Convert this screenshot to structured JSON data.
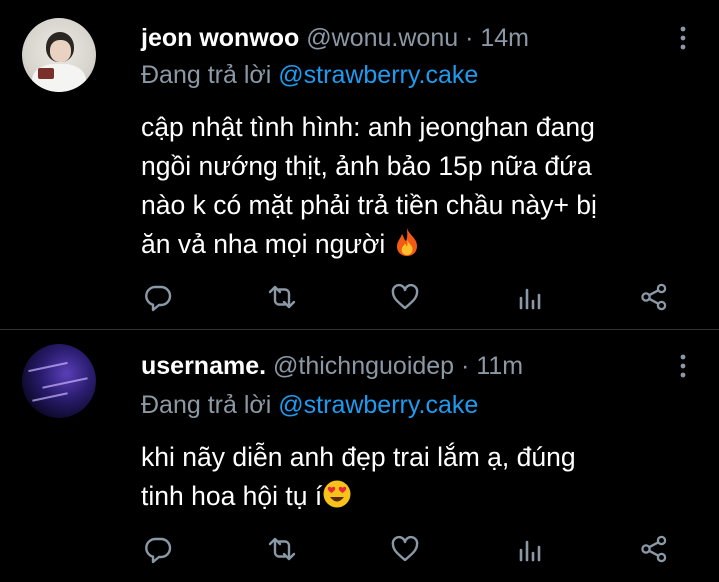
{
  "tweets": [
    {
      "name": "jeon wonwoo",
      "handle": "@wonu.wonu",
      "separator": "·",
      "time": "14m",
      "reply_prefix": "Đang trả lời",
      "reply_to": "@strawberry.cake",
      "lines": [
        "cập nhật tình hình: anh jeonghan đang",
        "ngồi nướng thịt, ảnh bảo 15p nữa đứa",
        "nào k có mặt phải trả tiền chầu này+ bị",
        "ăn vả nha mọi người"
      ],
      "emoji": "fire-emoji"
    },
    {
      "name": "username.",
      "handle": "@thichnguoidep",
      "separator": "·",
      "time": "11m",
      "reply_prefix": "Đang trả lời",
      "reply_to": "@strawberry.cake",
      "lines": [
        "khi nãy diễn anh đẹp trai lắm ạ, đúng",
        "tinh hoa hội tụ í"
      ],
      "emoji": "heart-eyes-emoji"
    }
  ],
  "icons": [
    "reply-icon",
    "retweet-icon",
    "like-icon",
    "analytics-icon",
    "share-icon",
    "more-icon"
  ],
  "colors": {
    "background": "#000000",
    "text": "#ffffff",
    "muted": "#8b98a5",
    "mention": "#1d9bf0",
    "divider": "#2f3336"
  }
}
